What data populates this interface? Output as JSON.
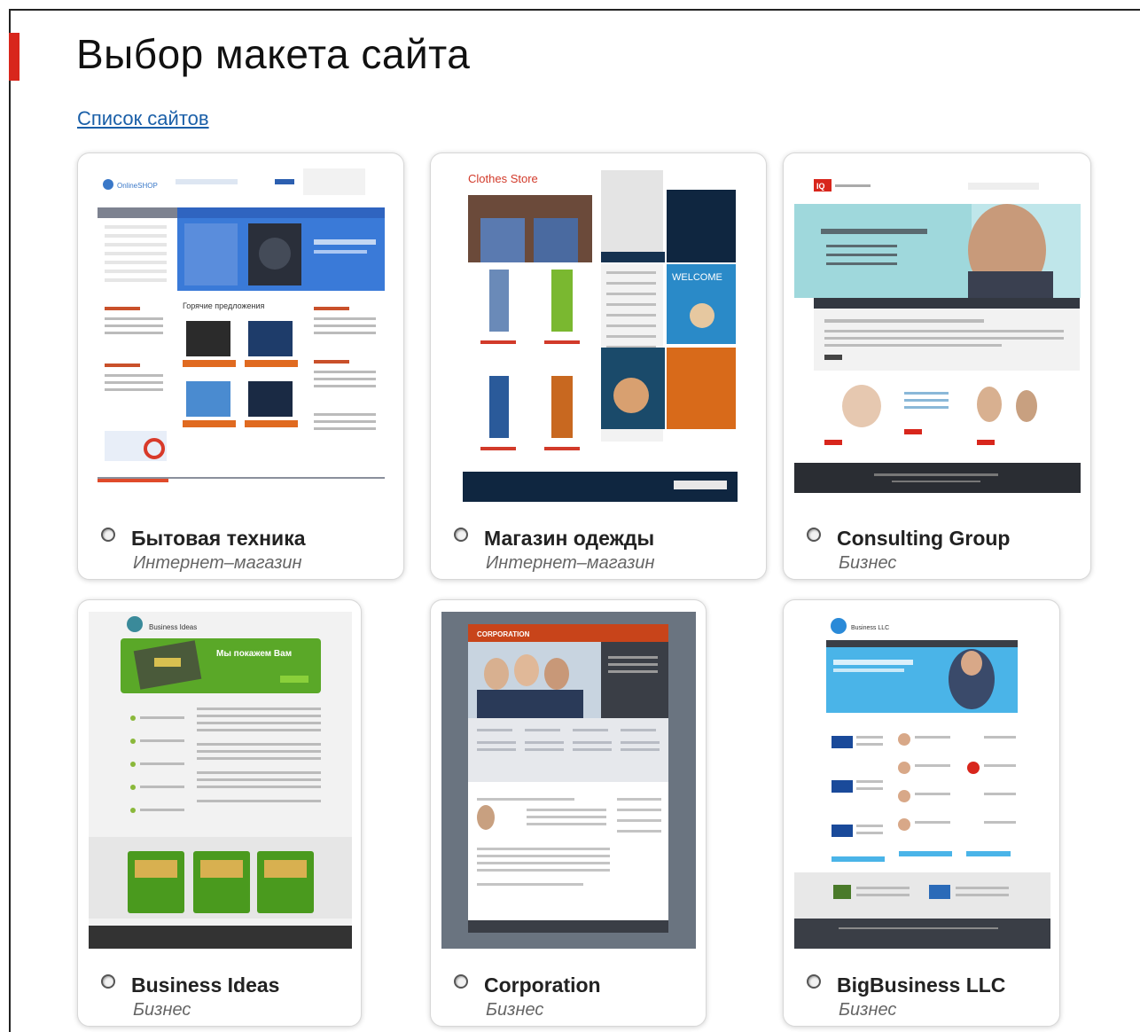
{
  "page": {
    "title": "Выбор макета сайта",
    "sites_link": "Список сайтов"
  },
  "colors": {
    "accent": "#d8261c",
    "link": "#1a5fa8"
  },
  "templates": [
    {
      "title": "Бытовая техника",
      "category": "Интернет–магазин",
      "preview": {
        "brand": "OnlineSHOP",
        "heading": "Горячие предложения"
      }
    },
    {
      "title": "Магазин одежды",
      "category": "Интернет–магазин",
      "preview": {
        "brand": "Clothes Store",
        "banner": "WELCOME"
      }
    },
    {
      "title": "Consulting Group",
      "category": "Бизнес",
      "preview": {
        "brand": "IQ"
      }
    },
    {
      "title": "Business Ideas",
      "category": "Бизнес",
      "preview": {
        "brand": "Business Ideas",
        "banner": "Мы покажем Вам"
      }
    },
    {
      "title": "Corporation",
      "category": "Бизнес",
      "preview": {
        "brand": "CORPORATION"
      }
    },
    {
      "title": "BigBusiness LLC",
      "category": "Бизнес",
      "preview": {
        "brand": "Business LLC"
      }
    }
  ]
}
